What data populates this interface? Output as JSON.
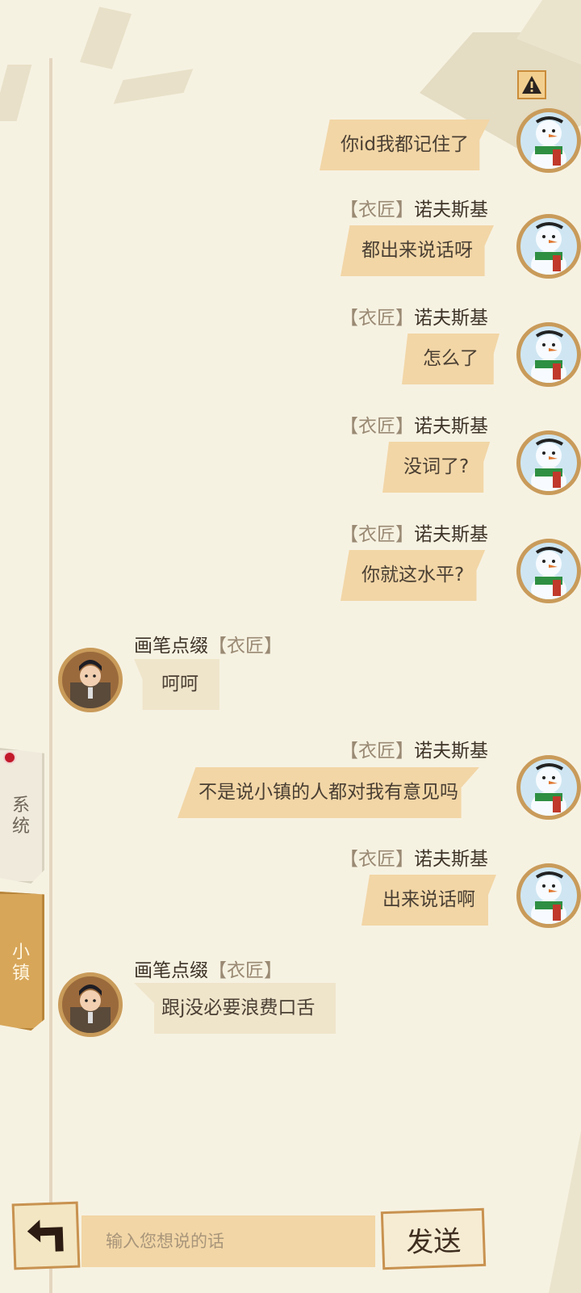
{
  "header": {
    "warn_icon": "warning-triangle-icon"
  },
  "sidebar": {
    "system_label": "系统",
    "town_label": "小镇"
  },
  "messages": [
    {
      "side": "right",
      "text": "你id我都记住了",
      "avatar": "snowman"
    },
    {
      "side": "right",
      "tag": "【衣匠】",
      "name": "诺夫斯基",
      "text": "都出来说话呀",
      "avatar": "snowman"
    },
    {
      "side": "right",
      "tag": "【衣匠】",
      "name": "诺夫斯基",
      "text": "怎么了",
      "avatar": "snowman"
    },
    {
      "side": "right",
      "tag": "【衣匠】",
      "name": "诺夫斯基",
      "text": "没词了?",
      "avatar": "snowman"
    },
    {
      "side": "right",
      "tag": "【衣匠】",
      "name": "诺夫斯基",
      "text": "你就这水平?",
      "avatar": "snowman"
    },
    {
      "side": "left",
      "name": "画笔点缀",
      "tag": "【衣匠】",
      "text": "呵呵",
      "avatar": "man"
    },
    {
      "side": "right",
      "tag": "【衣匠】",
      "name": "诺夫斯基",
      "text": "不是说小镇的人都对我有意见吗",
      "avatar": "snowman"
    },
    {
      "side": "right",
      "tag": "【衣匠】",
      "name": "诺夫斯基",
      "text": "出来说话啊",
      "avatar": "snowman"
    },
    {
      "side": "left",
      "name": "画笔点缀",
      "tag": "【衣匠】",
      "text": "跟j没必要浪费口舌",
      "avatar": "man"
    }
  ],
  "input": {
    "placeholder": "输入您想说的话",
    "value": ""
  },
  "buttons": {
    "send": "发送",
    "back_icon": "back-arrow-icon"
  },
  "colors": {
    "background": "#f6f2e2",
    "bubble_right": "#f2d6a6",
    "bubble_left": "#efe5cb",
    "accent": "#d7a659",
    "badge_red": "#c2192b"
  }
}
